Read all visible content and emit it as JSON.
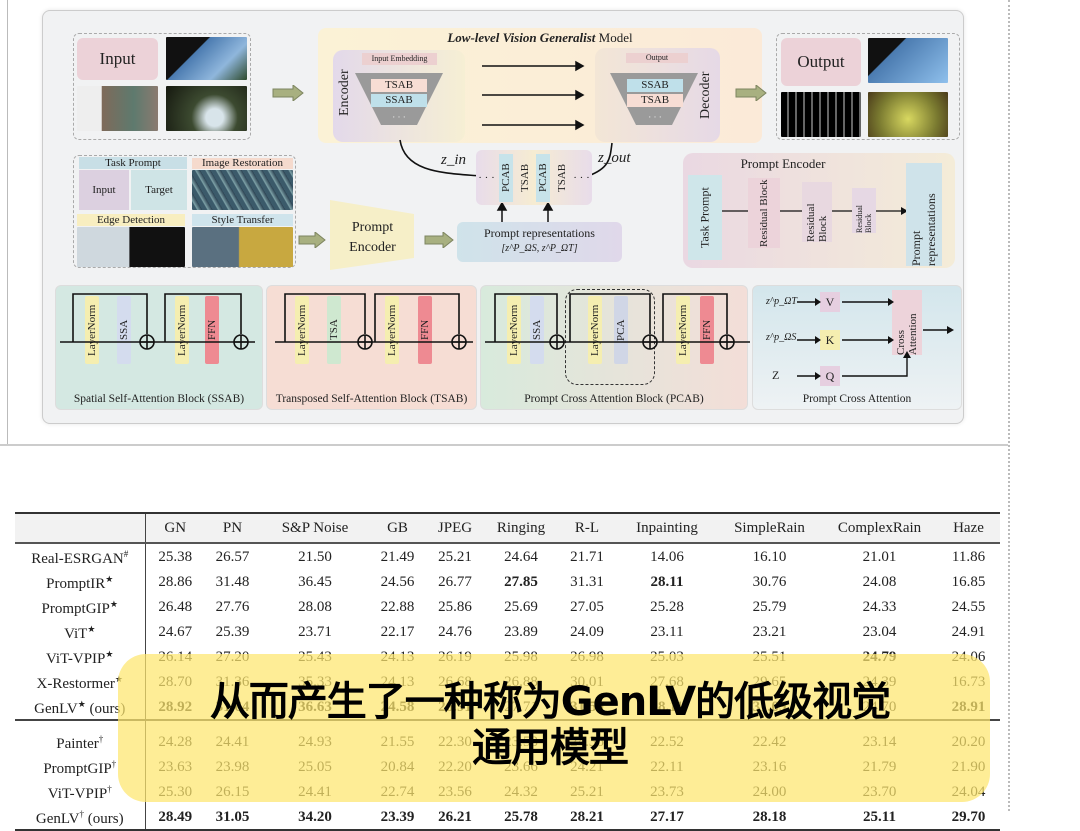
{
  "figure": {
    "title_italic": "Low-level Vision Generalist",
    "title_rest": " Model",
    "input_label": "Input",
    "output_label": "Output",
    "encoder_label": "Encoder",
    "decoder_label": "Decoder",
    "input_embedding": "Input Embedding",
    "output_small": "Output",
    "enc_blocks": [
      "TSAB",
      "SSAB",
      "· · ·"
    ],
    "dec_blocks": [
      "SSAB",
      "TSAB",
      "· · ·"
    ],
    "z_in": "z_in",
    "z_out": "z_out",
    "chain": [
      "· · ·",
      "PCAB",
      "TSAB",
      "PCAB",
      "TSAB",
      "· · ·"
    ],
    "task_prompt": "Task Prompt",
    "tp_input": "Input",
    "tp_target": "Target",
    "image_restoration": "Image Restoration",
    "edge_detection": "Edge Detection",
    "style_transfer": "Style Transfer",
    "prompt_encoder": "Prompt Encoder",
    "prompt_repr": "Prompt representations",
    "prompt_repr_math": "[z^P_ΩS, z^P_ΩT]",
    "pe_panel_title": "Prompt Encoder",
    "pe_task_prompt": "Task Prompt",
    "pe_residual": [
      "Residual Block",
      "Residual Block",
      "Residual Block"
    ],
    "pe_output": "Prompt representations",
    "ssab": {
      "caption": "Spatial Self-Attention Block (SSAB)",
      "bars": [
        "LayerNorm",
        "SSA",
        "LayerNorm",
        "FFN"
      ]
    },
    "tsab": {
      "caption": "Transposed Self-Attention Block (TSAB)",
      "bars": [
        "LayerNorm",
        "TSA",
        "LayerNorm",
        "FFN"
      ]
    },
    "pcab": {
      "caption": "Prompt Cross Attention Block (PCAB)",
      "bars": [
        "LayerNorm",
        "SSA",
        "LayerNorm",
        "PCA",
        "LayerNorm",
        "FFN"
      ]
    },
    "pca": {
      "caption": "Prompt Cross Attention",
      "inputs": [
        "z^p_ΩT",
        "z^p_ΩS",
        "Z"
      ],
      "nodes": [
        "V",
        "K",
        "Q"
      ],
      "cross": "Cross Attention"
    }
  },
  "table": {
    "headers": [
      "",
      "GN",
      "PN",
      "S&P Noise",
      "GB",
      "JPEG",
      "Ringing",
      "R-L",
      "Inpainting",
      "SimpleRain",
      "ComplexRain",
      "Haze"
    ],
    "groups": [
      [
        {
          "name": "Real-ESRGAN",
          "mark": "#",
          "suffix": "",
          "values": [
            "25.38",
            "26.57",
            "21.50",
            "21.49",
            "25.21",
            "24.64",
            "21.71",
            "14.06",
            "16.10",
            "21.01",
            "11.86"
          ],
          "bold": []
        },
        {
          "name": "PromptIR",
          "mark": "★",
          "suffix": "",
          "values": [
            "28.86",
            "31.48",
            "36.45",
            "24.56",
            "26.77",
            "27.85",
            "31.31",
            "28.11",
            "30.76",
            "24.08",
            "16.85"
          ],
          "bold": [
            5,
            7
          ]
        },
        {
          "name": "PromptGIP",
          "mark": "★",
          "suffix": "",
          "values": [
            "26.48",
            "27.76",
            "28.08",
            "22.88",
            "25.86",
            "25.69",
            "27.05",
            "25.28",
            "25.79",
            "24.33",
            "24.55"
          ],
          "bold": []
        },
        {
          "name": "ViT",
          "mark": "★",
          "suffix": "",
          "values": [
            "24.67",
            "25.39",
            "23.71",
            "22.17",
            "24.76",
            "23.89",
            "24.09",
            "23.11",
            "23.21",
            "23.04",
            "24.91"
          ],
          "bold": []
        },
        {
          "name": "ViT-VPIP",
          "mark": "★",
          "suffix": "",
          "values": [
            "26.14",
            "27.20",
            "25.43",
            "24.13",
            "26.19",
            "25.98",
            "26.98",
            "25.03",
            "25.51",
            "24.79",
            "24.06"
          ],
          "bold": [
            9
          ]
        },
        {
          "name": "X-Restormer",
          "mark": "★",
          "suffix": "",
          "values": [
            "28.70",
            "31.36",
            "35.33",
            "24.13",
            "26.68",
            "26.88",
            "30.01",
            "27.68",
            "29.65",
            "24.39",
            "16.73"
          ],
          "bold": []
        },
        {
          "name": "GenLV",
          "mark": "★",
          "suffix": " (ours)",
          "values": [
            "28.92",
            "31.64",
            "36.63",
            "24.58",
            "26.91",
            "27.71",
            "31.50",
            "28.11",
            "31.09",
            "24.70",
            "28.91"
          ],
          "bold": [
            0,
            1,
            2,
            3,
            4,
            6,
            7,
            8,
            10
          ]
        }
      ],
      [
        {
          "name": "Painter",
          "mark": "†",
          "suffix": "",
          "values": [
            "24.28",
            "24.41",
            "24.93",
            "21.55",
            "22.30",
            "23.58",
            "24.36",
            "22.52",
            "22.42",
            "23.14",
            "20.20"
          ],
          "bold": []
        },
        {
          "name": "PromptGIP",
          "mark": "†",
          "suffix": "",
          "values": [
            "23.63",
            "23.98",
            "25.05",
            "20.84",
            "22.20",
            "23.66",
            "24.21",
            "22.11",
            "23.16",
            "21.79",
            "21.90"
          ],
          "bold": []
        },
        {
          "name": "ViT-VPIP",
          "mark": "†",
          "suffix": "",
          "values": [
            "25.30",
            "26.15",
            "24.41",
            "22.74",
            "23.56",
            "24.32",
            "25.21",
            "23.73",
            "24.00",
            "23.70",
            "24.04"
          ],
          "bold": []
        },
        {
          "name": "GenLV",
          "mark": "†",
          "suffix": " (ours)",
          "values": [
            "28.49",
            "31.05",
            "34.20",
            "23.39",
            "26.21",
            "25.78",
            "28.21",
            "27.17",
            "28.18",
            "25.11",
            "29.70"
          ],
          "bold": [
            0,
            1,
            2,
            3,
            4,
            5,
            6,
            7,
            8,
            9,
            10
          ]
        }
      ]
    ]
  },
  "subtitle": {
    "line1": "从而产生了一种称为GenLV的低级视觉",
    "line2": "通用模型",
    "highlight": "#fde66e"
  }
}
